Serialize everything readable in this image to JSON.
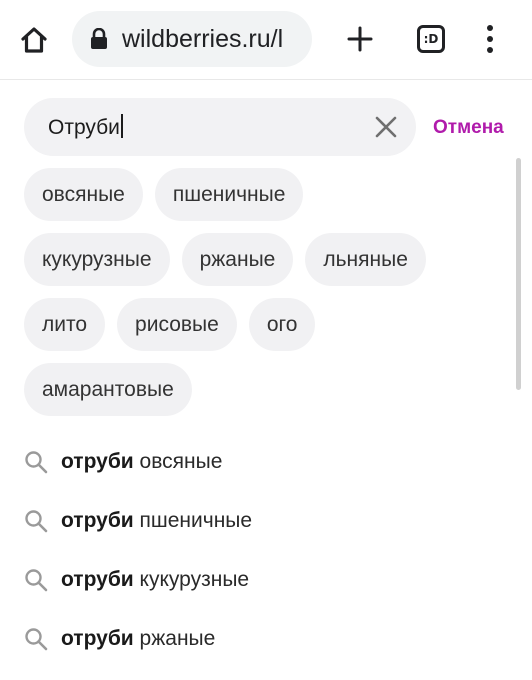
{
  "browser": {
    "url": "wildberries.ru/l",
    "tabs_count": ":D"
  },
  "search": {
    "value": "Отруби",
    "cancel_label": "Отмена"
  },
  "chips": [
    [
      "овсяные",
      "пшеничные"
    ],
    [
      "кукурузные",
      "ржаные",
      "льняные"
    ],
    [
      "лито",
      "рисовые",
      "ого"
    ],
    [
      "амарантовые"
    ]
  ],
  "suggestions": [
    {
      "bold": "отруби",
      "rest": " овсяные"
    },
    {
      "bold": "отруби",
      "rest": " пшеничные"
    },
    {
      "bold": "отруби",
      "rest": " кукурузные"
    },
    {
      "bold": "отруби",
      "rest": " ржаные"
    }
  ],
  "colors": {
    "accent": "#b01bab",
    "chip_bg": "#f1f1f3",
    "url_bg": "#f1f3f4"
  },
  "icons": {
    "home": "home-icon",
    "lock": "lock-icon",
    "new_tab": "plus-icon",
    "tabs": "tab-switcher-icon",
    "menu": "more-vert-icon",
    "clear": "close-icon",
    "suggestion": "search-icon"
  }
}
